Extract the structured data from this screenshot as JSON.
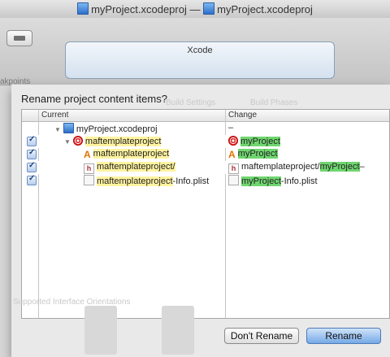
{
  "window": {
    "title_left": "myProject.xcodeproj",
    "title_sep": "—",
    "title_right": "myProject.xcodeproj"
  },
  "toolbar": {
    "activity_title": "Xcode",
    "breakpoints_label": "akpoints"
  },
  "dialog": {
    "title": "Rename project content items?",
    "columns": {
      "current": "Current",
      "change": "Change"
    },
    "rows": [
      {
        "checked": false,
        "icon": "project-file-icon",
        "current": "myProject.xcodeproj",
        "current_hl": "",
        "current_rest": "",
        "change": "–",
        "change_hl": "",
        "change_rest": ""
      },
      {
        "checked": true,
        "icon": "target-icon",
        "current": "",
        "current_hl": "maftemplateproject",
        "current_rest": "",
        "change": "",
        "change_hl": "myProject",
        "change_rest": ""
      },
      {
        "checked": true,
        "icon": "app-icon",
        "current": "",
        "current_hl": "maftemplateproject",
        "current_rest": "",
        "change": "",
        "change_hl": "myProject",
        "change_rest": ""
      },
      {
        "checked": true,
        "icon": "header-file-icon",
        "current": "",
        "current_hl": "maftemplateproject/",
        "current_rest": "",
        "change": "maftemplateproject/",
        "change_hl": "myProject",
        "change_rest": "–"
      },
      {
        "checked": true,
        "icon": "plist-file-icon",
        "current": "",
        "current_hl": "maftemplateproject",
        "current_rest": "-Info.plist",
        "change": "",
        "change_hl": "myProject",
        "change_rest": "-Info.plist"
      }
    ],
    "buttons": {
      "dont_rename": "Don't Rename",
      "rename": "Rename"
    }
  },
  "background_text": {
    "build_settings": "Build Settings",
    "build_phases": "Build Phases",
    "interface_orientations": "Supported Interface Orientations"
  }
}
